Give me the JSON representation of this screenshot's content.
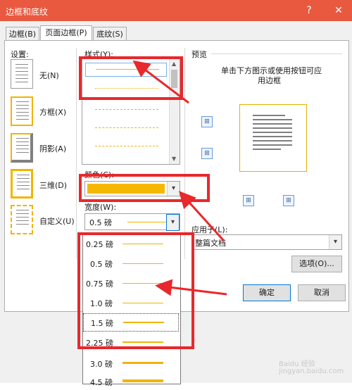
{
  "window": {
    "title": "边框和底纹",
    "help": "?",
    "close": "✕"
  },
  "tabs": [
    "边框(B)",
    "页面边框(P)",
    "底纹(S)"
  ],
  "settings": {
    "heading": "设置:",
    "items": [
      "无(N)",
      "方框(X)",
      "阴影(A)",
      "三维(D)",
      "自定义(U)"
    ]
  },
  "style": {
    "label": "样式(Y):"
  },
  "color": {
    "label": "颜色(C):",
    "value_color": "#f5b800"
  },
  "width": {
    "label": "宽度(W):",
    "value": "0.5 磅"
  },
  "width_options": [
    "0.25 磅",
    "0.5 磅",
    "0.75 磅",
    "1.0 磅",
    "1.5 磅",
    "2.25 磅",
    "3.0 磅",
    "4.5 磅"
  ],
  "preview": {
    "label": "预览",
    "hint_line1": "单击下方图示或使用按钮可应",
    "hint_line2": "用边框"
  },
  "apply_to": {
    "label": "应用于(L):",
    "value": "整篇文档"
  },
  "buttons": {
    "options": "选项(O)...",
    "ok": "确定",
    "cancel": "取消"
  },
  "watermark": {
    "line1": "Baidu 经验",
    "line2": "jingyan.baidu.com"
  },
  "colors": {
    "titlebar": "#e8593f",
    "border_accent": "#f2b400",
    "annotation_red": "#e8282c"
  }
}
